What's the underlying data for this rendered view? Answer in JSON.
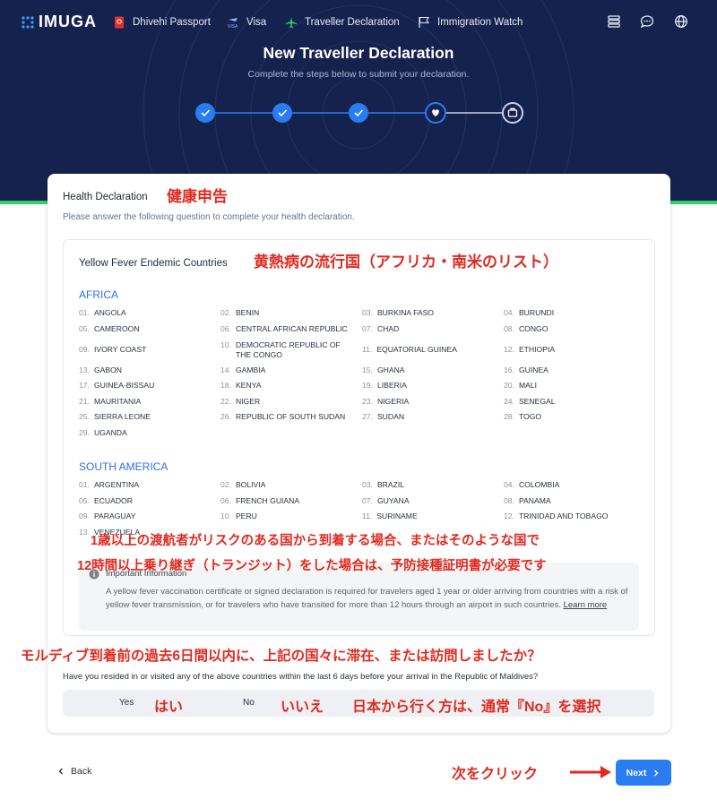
{
  "nav": {
    "logo": "IMUGA",
    "links": [
      {
        "label": "Dhivehi Passport",
        "icon": "passport-icon"
      },
      {
        "label": "Visa",
        "icon": "visa-icon"
      },
      {
        "label": "Traveller Declaration",
        "icon": "plane-icon"
      },
      {
        "label": "Immigration Watch",
        "icon": "flag-icon"
      }
    ],
    "right_icons": [
      "list-icon",
      "chat-icon",
      "globe-icon"
    ]
  },
  "header": {
    "title": "New Traveller Declaration",
    "subtitle": "Complete the steps below to submit your declaration."
  },
  "stepper": {
    "steps": [
      {
        "state": "done",
        "icon": "check-icon"
      },
      {
        "state": "done",
        "icon": "check-icon"
      },
      {
        "state": "done",
        "icon": "check-icon"
      },
      {
        "state": "current",
        "icon": "heart-icon"
      },
      {
        "state": "upcoming",
        "icon": "luggage-icon"
      }
    ]
  },
  "colors": {
    "navy": "#16224e",
    "accent": "#2a7df0",
    "green": "#2fcf6a",
    "annotation": "#e02a20"
  },
  "card": {
    "title": "Health Declaration",
    "subtitle": "Please answer the following question to complete your health declaration."
  },
  "endemic": {
    "title": "Yellow Fever Endemic Countries",
    "africa": {
      "title": "AFRICA",
      "countries": [
        {
          "n": "01.",
          "name": "ANGOLA"
        },
        {
          "n": "02.",
          "name": "BENIN"
        },
        {
          "n": "03.",
          "name": "BURKINA FASO"
        },
        {
          "n": "04.",
          "name": "BURUNDI"
        },
        {
          "n": "05.",
          "name": "CAMEROON"
        },
        {
          "n": "06.",
          "name": "CENTRAL AFRICAN REPUBLIC"
        },
        {
          "n": "07.",
          "name": "CHAD"
        },
        {
          "n": "08.",
          "name": "CONGO"
        },
        {
          "n": "09.",
          "name": "IVORY COAST"
        },
        {
          "n": "10.",
          "name": "DEMOCRATIC REPUBLIC OF THE CONGO"
        },
        {
          "n": "11.",
          "name": "EQUATORIAL GUINEA"
        },
        {
          "n": "12.",
          "name": "ETHIOPIA"
        },
        {
          "n": "13.",
          "name": "GABON"
        },
        {
          "n": "14.",
          "name": "GAMBIA"
        },
        {
          "n": "15.",
          "name": "GHANA"
        },
        {
          "n": "16.",
          "name": "GUINEA"
        },
        {
          "n": "17.",
          "name": "GUINEA-BISSAU"
        },
        {
          "n": "18.",
          "name": "KENYA"
        },
        {
          "n": "19.",
          "name": "LIBERIA"
        },
        {
          "n": "20.",
          "name": "MALI"
        },
        {
          "n": "21.",
          "name": "MAURITANIA"
        },
        {
          "n": "22.",
          "name": "NIGER"
        },
        {
          "n": "23.",
          "name": "NIGERIA"
        },
        {
          "n": "24.",
          "name": "SENEGAL"
        },
        {
          "n": "25.",
          "name": "SIERRA LEONE"
        },
        {
          "n": "26.",
          "name": "REPUBLIC OF SOUTH SUDAN"
        },
        {
          "n": "27.",
          "name": "SUDAN"
        },
        {
          "n": "28.",
          "name": "TOGO"
        },
        {
          "n": "29.",
          "name": "UGANDA"
        }
      ]
    },
    "south_america": {
      "title": "SOUTH AMERICA",
      "countries": [
        {
          "n": "01.",
          "name": "ARGENTINA"
        },
        {
          "n": "02.",
          "name": "BOLIVIA"
        },
        {
          "n": "03.",
          "name": "BRAZIL"
        },
        {
          "n": "04.",
          "name": "COLOMBIA"
        },
        {
          "n": "05.",
          "name": "ECUADOR"
        },
        {
          "n": "06.",
          "name": "FRENCH GUIANA"
        },
        {
          "n": "07.",
          "name": "GUYANA"
        },
        {
          "n": "08.",
          "name": "PANAMA"
        },
        {
          "n": "09.",
          "name": "PARAGUAY"
        },
        {
          "n": "10.",
          "name": "PERU"
        },
        {
          "n": "11.",
          "name": "SURINAME"
        },
        {
          "n": "12.",
          "name": "TRINIDAD AND TOBAGO"
        },
        {
          "n": "13.",
          "name": "VENEZUELA"
        }
      ]
    }
  },
  "info": {
    "title": "Important Information",
    "body": "A yellow fever vaccination certificate or signed declaration is required for travelers aged 1 year or older arriving from countries with a risk of yellow fever transmission, or for travelers who have transited for more than 12 hours through an airport in such countries.",
    "link": "Learn more"
  },
  "question": "Have you resided in or visited any of the above countries within the last 6 days before your arrival in the Republic of Maldives?",
  "toggle": {
    "yes": "Yes",
    "no": "No"
  },
  "footer": {
    "back": "Back",
    "next": "Next"
  },
  "annotations": {
    "health": "健康申告",
    "endemic": "黄熱病の流行国（アフリカ・南米のリスト）",
    "cert_line1": "1歳以上の渡航者がリスクのある国から到着する場合、またはそのような国で",
    "cert_line2": "12時間以上乗り継ぎ（トランジット）をした場合は、予防接種証明書が必要です",
    "question": "モルディブ到着前の過去6日間以内に、上記の国々に滞在、または訪問しましたか？",
    "yes": "はい",
    "no": "いいえ",
    "japan": "日本から行く方は、通常『No』を選択",
    "next": "次をクリック"
  }
}
